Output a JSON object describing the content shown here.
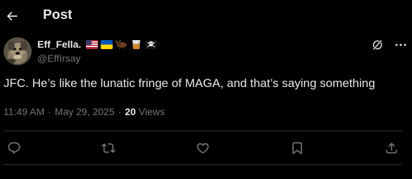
{
  "header": {
    "title": "Post",
    "back_icon": "arrow-left-icon"
  },
  "author": {
    "display_name": "Eff_Fella.",
    "handle": "@EffIrsay",
    "avatar": "dog-avatar",
    "badges": [
      "flag-us-icon",
      "flag-ukraine-icon",
      "bison-icon",
      "whiskey-glass-icon",
      "skull-crossbones-icon"
    ]
  },
  "post": {
    "text": "JFC. He’s like the lunatic fringe of MAGA, and that’s saying something",
    "time": "11:49 AM",
    "date": "May 29, 2025",
    "meta_separator": "·",
    "views_count": "20",
    "views_label": "Views"
  },
  "actions": [
    "reply-icon",
    "repost-icon",
    "like-icon",
    "bookmark-icon",
    "share-icon"
  ],
  "colors": {
    "background": "#000000",
    "primary_text": "#e7e9ea",
    "secondary_text": "#71767b",
    "divider": "#2f3336"
  }
}
